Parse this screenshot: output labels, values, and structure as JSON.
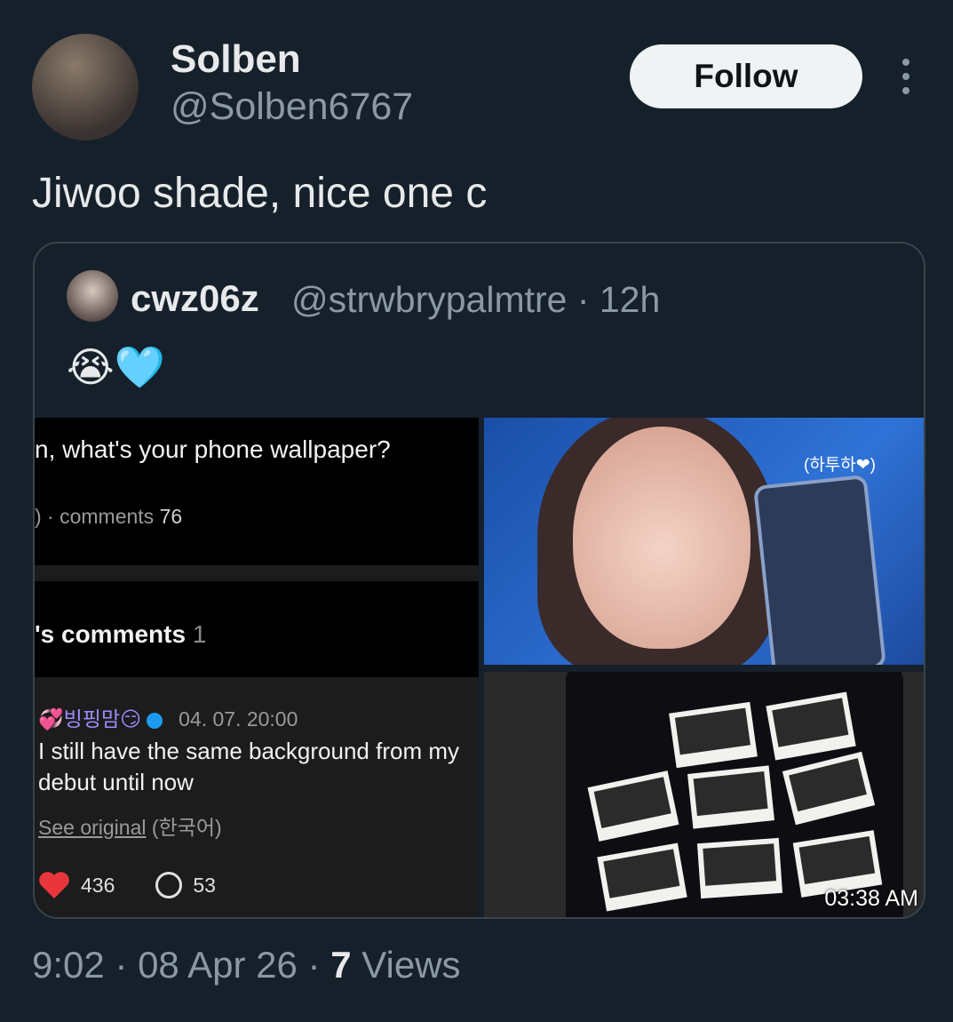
{
  "author": {
    "name": "Solben",
    "handle": "@Solben6767",
    "follow_label": "Follow"
  },
  "tweet": {
    "text": "Jiwoo shade, nice one c"
  },
  "quote": {
    "name": "cwz06z",
    "meta": "@strwbrypalmtre · 12h",
    "emoji": "😭🩵",
    "screenshot": {
      "question": "n, what's your phone wallpaper?",
      "stats_prefix": ")  ·  comments",
      "stats_count": "76",
      "section_title": "'s comments",
      "section_count": "1",
      "username": "💞빙핑맘😏",
      "date": "04. 07. 20:00",
      "comment_line1": "I still have the same background from my",
      "comment_line2": "debut until now",
      "see_original": "See original",
      "language": "(한국어)",
      "likes": "436",
      "replies": "53"
    },
    "photo_tag": "(하투하❤)",
    "photo_time": "03:38 AM"
  },
  "footer": {
    "time_date": "9:02 · 08 Apr 26 · ",
    "views_count": "7",
    "views_label": " Views"
  }
}
